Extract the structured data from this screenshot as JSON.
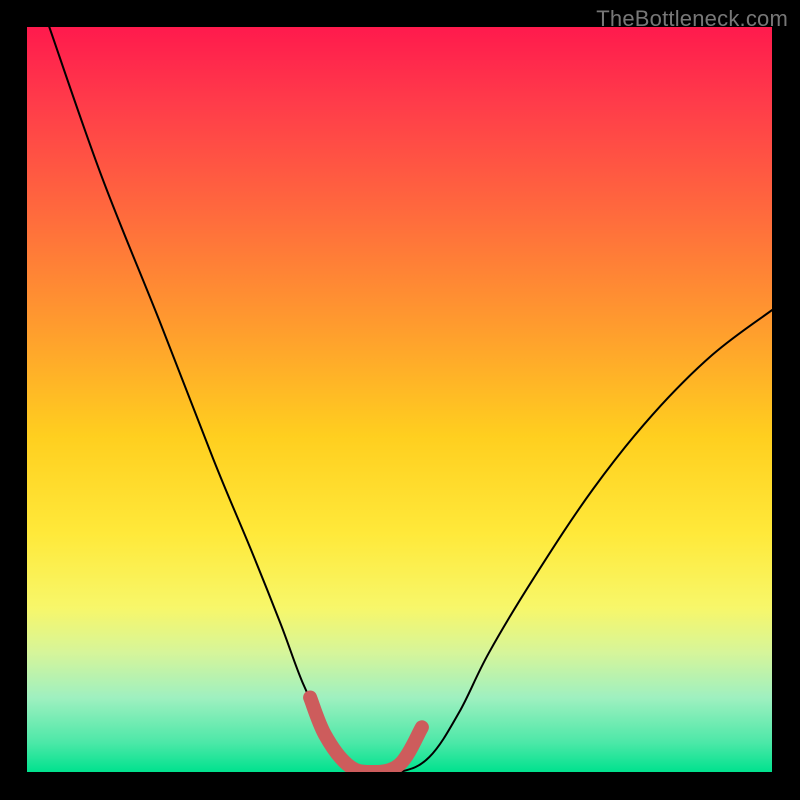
{
  "watermark": "TheBottleneck.com",
  "chart_data": {
    "type": "line",
    "title": "",
    "xlabel": "",
    "ylabel": "",
    "xlim": [
      0,
      100
    ],
    "ylim": [
      0,
      100
    ],
    "series": [
      {
        "name": "bottleneck-curve",
        "x": [
          3,
          10,
          18,
          25,
          30,
          34,
          37,
          40,
          43,
          46,
          50,
          54,
          58,
          62,
          68,
          76,
          84,
          92,
          100
        ],
        "y": [
          100,
          80,
          60,
          42,
          30,
          20,
          12,
          6,
          2,
          0,
          0,
          2,
          8,
          16,
          26,
          38,
          48,
          56,
          62
        ]
      },
      {
        "name": "bottom-highlight",
        "x": [
          38,
          40,
          43,
          46,
          50,
          53
        ],
        "y": [
          10,
          5,
          1,
          0,
          1,
          6
        ]
      }
    ],
    "colors": {
      "curve": "#000000",
      "highlight": "#cd5c5c",
      "gradient_top": "#ff1a4d",
      "gradient_bottom": "#00e28e"
    }
  }
}
